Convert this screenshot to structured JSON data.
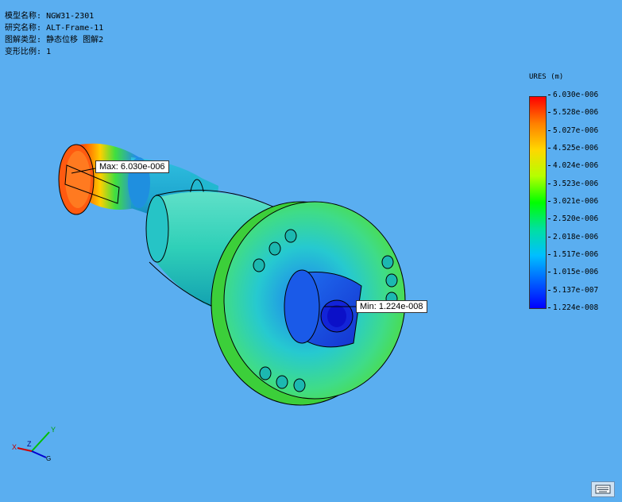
{
  "info": {
    "model_label": "模型名称:",
    "model_value": "NGW31-2301",
    "study_label": "研究名称:",
    "study_value": "ALT-Frame-11",
    "plot_label": "图解类型:",
    "plot_value": "静态位移 图解2",
    "scale_label": "变形比例:",
    "scale_value": "1"
  },
  "legend": {
    "title": "URES (m)",
    "ticks": [
      "6.030e-006",
      "5.528e-006",
      "5.027e-006",
      "4.525e-006",
      "4.024e-006",
      "3.523e-006",
      "3.021e-006",
      "2.520e-006",
      "2.018e-006",
      "1.517e-006",
      "1.015e-006",
      "5.137e-007",
      "1.224e-008"
    ],
    "colors": [
      "#ff0000",
      "#ff7f00",
      "#ffd700",
      "#b5ff00",
      "#00ff00",
      "#00e0a0",
      "#00bfff",
      "#0060ff",
      "#0000ff"
    ]
  },
  "callouts": {
    "max": "Max: 6.030e-006",
    "min": "Min: 1.224e-008"
  },
  "triad": {
    "x": "X",
    "y": "Y",
    "z": "Z",
    "g": "G"
  },
  "icons": {
    "keyboard": "keyboard-icon"
  }
}
